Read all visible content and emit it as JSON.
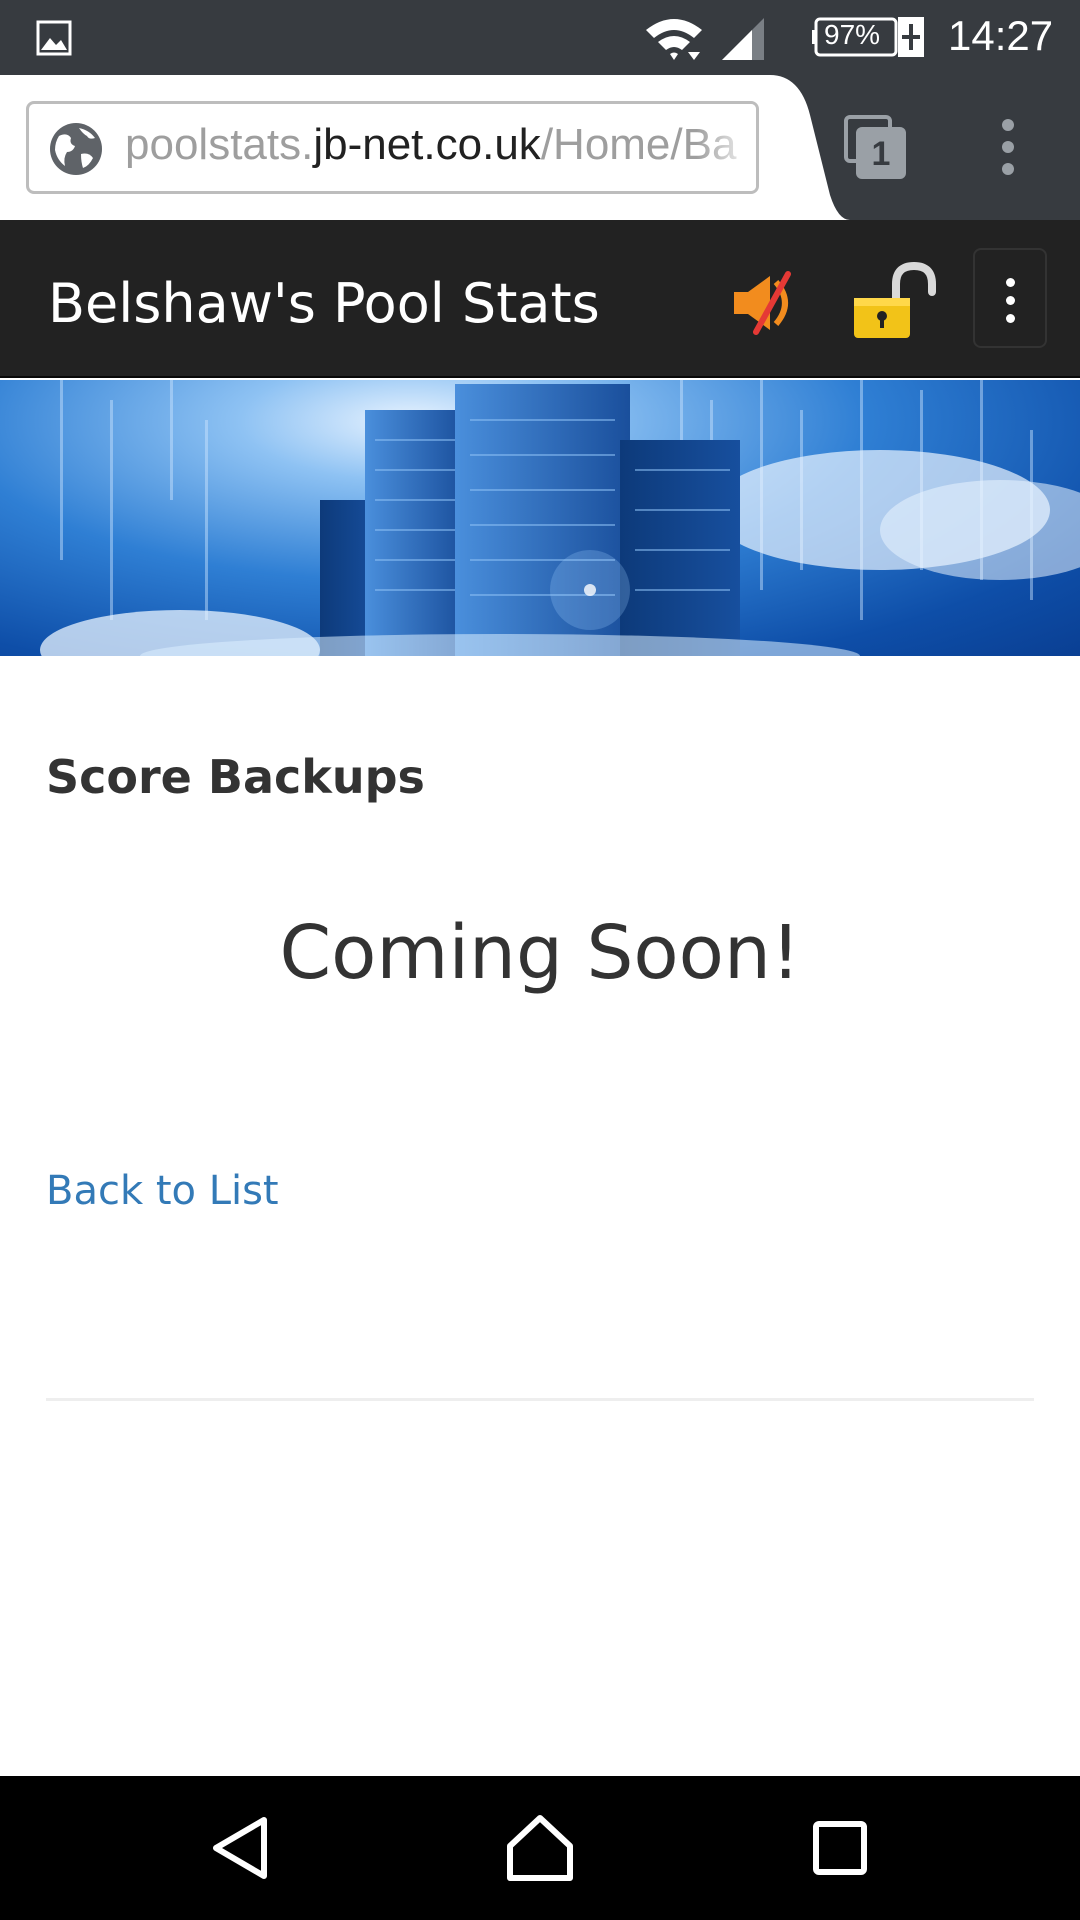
{
  "status_bar": {
    "battery_percent": "97%",
    "time": "14:27"
  },
  "browser": {
    "url_prefix": "poolstats.",
    "url_domain": "jb-net.co.uk",
    "url_path": "/Home/Ba",
    "tab_count": "1"
  },
  "navbar": {
    "brand": "Belshaw's Pool Stats",
    "icons": [
      "mute-icon",
      "unlock-icon",
      "more-vertical-icon"
    ],
    "accent_colors": {
      "mute": "#f28c1e",
      "lock": "#f2c318"
    }
  },
  "main": {
    "title": "Score Backups",
    "message": "Coming Soon!",
    "back_link": "Back to List"
  },
  "system_nav": {
    "icons": [
      "back-icon",
      "home-icon",
      "recent-apps-icon"
    ]
  },
  "colors": {
    "status_bar": "#373b40",
    "navbar": "#222222",
    "link": "#337ab7",
    "text": "#333333"
  }
}
